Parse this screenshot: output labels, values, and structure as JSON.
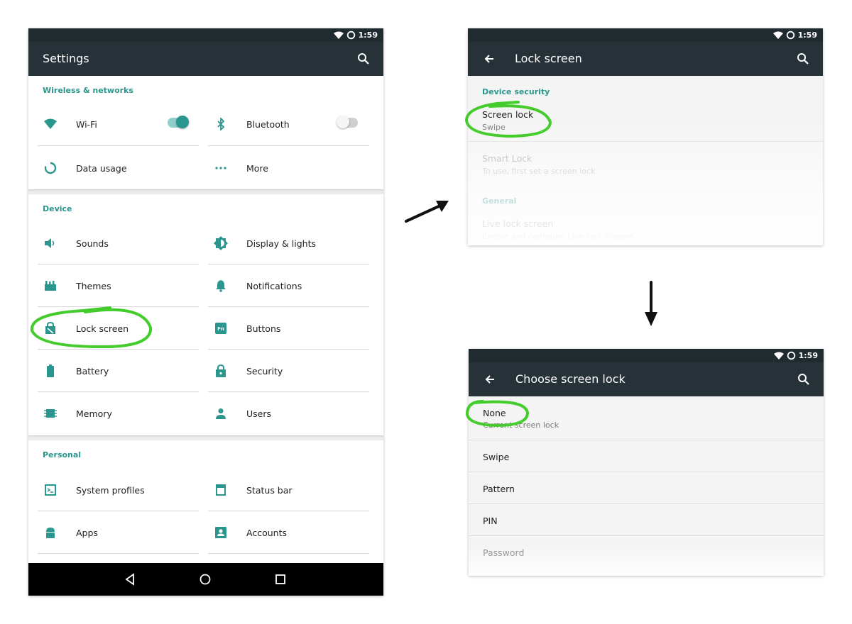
{
  "status_bar": {
    "time": "1:59"
  },
  "settings": {
    "title": "Settings",
    "sections": {
      "wireless": {
        "header": "Wireless & networks",
        "wifi": "Wi-Fi",
        "bluetooth": "Bluetooth",
        "data_usage": "Data usage",
        "more": "More"
      },
      "device": {
        "header": "Device",
        "sounds": "Sounds",
        "display": "Display & lights",
        "themes": "Themes",
        "notifications": "Notifications",
        "lock_screen": "Lock screen",
        "buttons": "Buttons",
        "battery": "Battery",
        "security": "Security",
        "memory": "Memory",
        "users": "Users"
      },
      "personal": {
        "header": "Personal",
        "system_profiles": "System profiles",
        "status_bar": "Status bar",
        "apps": "Apps",
        "accounts": "Accounts"
      }
    },
    "toggles": {
      "wifi_on": true,
      "bluetooth_on": false
    }
  },
  "lock_screen": {
    "title": "Lock screen",
    "device_security_header": "Device security",
    "screen_lock_title": "Screen lock",
    "screen_lock_summary": "Swipe",
    "smart_lock_title": "Smart Lock",
    "smart_lock_summary": "To use, first set a screen lock",
    "general_header": "General",
    "live_lock_title": "Live lock screen",
    "live_lock_summary": "Enable and configure Live lock screens"
  },
  "choose_lock": {
    "title": "Choose screen lock",
    "none_title": "None",
    "none_summary": "Current screen lock",
    "swipe": "Swipe",
    "pattern": "Pattern",
    "pin": "PIN",
    "password": "Password"
  },
  "colors": {
    "accent": "#2a968d",
    "toolbar": "#263238",
    "status_bar": "#202b30",
    "highlight": "#44cc2c",
    "navbar": "#000000"
  }
}
